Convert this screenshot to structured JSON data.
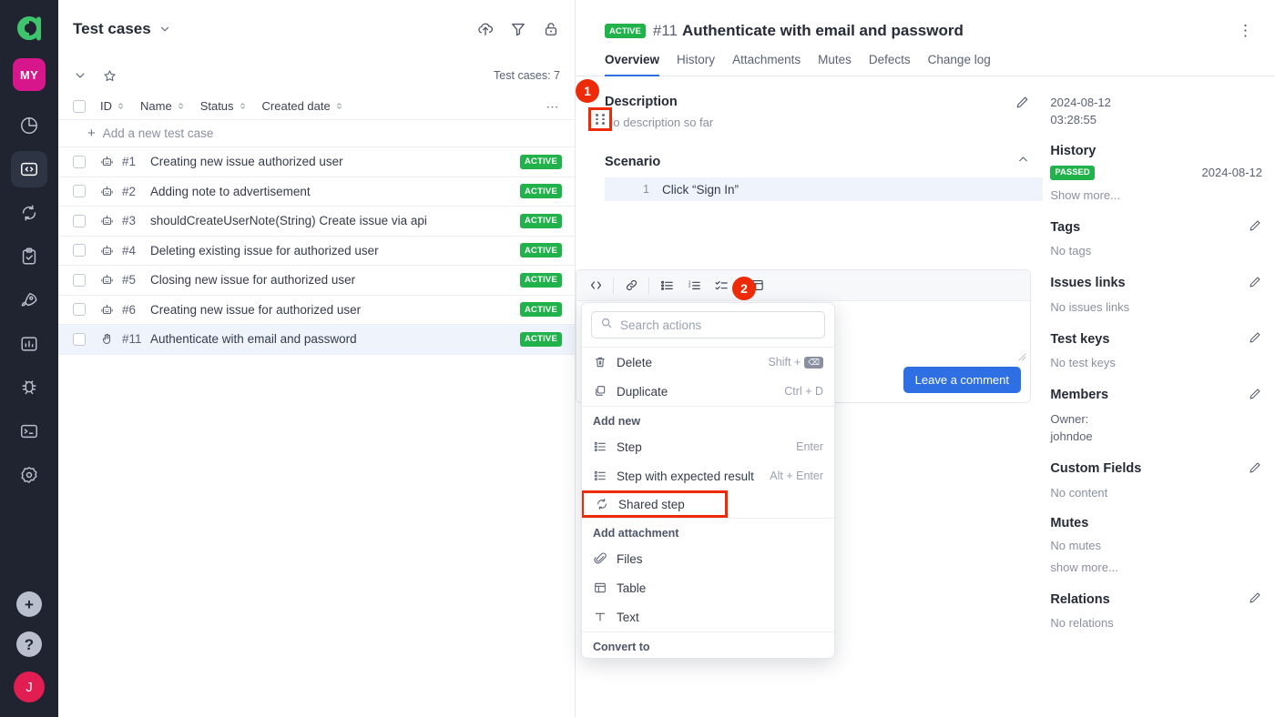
{
  "rail": {
    "logo_name": "allure-logo",
    "project_badge": "MY",
    "nav": [
      {
        "id": "dashboards",
        "icon": "pie-chart-icon",
        "active": false
      },
      {
        "id": "test-cases",
        "icon": "code-brackets-icon",
        "active": true
      },
      {
        "id": "shared-steps",
        "icon": "sync-arrows-icon",
        "active": false
      },
      {
        "id": "test-plans",
        "icon": "clipboard-check-icon",
        "active": false
      },
      {
        "id": "launches",
        "icon": "rocket-icon",
        "active": false
      },
      {
        "id": "analytics",
        "icon": "bar-chart-icon",
        "active": false
      },
      {
        "id": "defects",
        "icon": "bug-icon",
        "active": false
      },
      {
        "id": "jobs",
        "icon": "terminal-icon",
        "active": false
      },
      {
        "id": "settings",
        "icon": "gear-icon",
        "active": false
      }
    ],
    "bottom": [
      {
        "id": "create",
        "icon": "plus-icon",
        "glyph": "+"
      },
      {
        "id": "help",
        "icon": "question-icon",
        "glyph": "?"
      },
      {
        "id": "user-avatar",
        "icon": "avatar",
        "glyph": "J"
      }
    ]
  },
  "list": {
    "title": "Test cases",
    "title_chevron": "chevron-down-icon",
    "header_tools": [
      "upload-icon",
      "filter-icon",
      "unlock-icon"
    ],
    "subbar_icons": [
      "chevron-down-icon",
      "star-icon"
    ],
    "count_label": "Test cases: 7",
    "columns": [
      "ID",
      "Name",
      "Status",
      "Created date"
    ],
    "more_label": "⋯",
    "add_row_label": "Add a new test case",
    "rows": [
      {
        "id": "#1",
        "name": "Creating new issue authorized user",
        "status": "ACTIVE",
        "icon": "automated-icon",
        "selected": false
      },
      {
        "id": "#2",
        "name": "Adding note to advertisement",
        "status": "ACTIVE",
        "icon": "automated-icon",
        "selected": false
      },
      {
        "id": "#3",
        "name": "shouldCreateUserNote(String) Create issue via api",
        "status": "ACTIVE",
        "icon": "automated-icon",
        "selected": false
      },
      {
        "id": "#4",
        "name": "Deleting existing issue for authorized user",
        "status": "ACTIVE",
        "icon": "automated-icon",
        "selected": false
      },
      {
        "id": "#5",
        "name": "Closing new issue for authorized user",
        "status": "ACTIVE",
        "icon": "automated-icon",
        "selected": false
      },
      {
        "id": "#6",
        "name": "Creating new issue for authorized user",
        "status": "ACTIVE",
        "icon": "automated-icon",
        "selected": false
      },
      {
        "id": "#11",
        "name": "Authenticate with email and password",
        "status": "ACTIVE",
        "icon": "manual-hand-icon",
        "selected": true
      }
    ]
  },
  "detail": {
    "status_badge": "ACTIVE",
    "number": "#11",
    "title": "Authenticate with email and password",
    "kebab": "⋮",
    "tabs": [
      {
        "label": "Overview",
        "active": true
      },
      {
        "label": "History",
        "active": false
      },
      {
        "label": "Attachments",
        "active": false
      },
      {
        "label": "Mutes",
        "active": false
      },
      {
        "label": "Defects",
        "active": false
      },
      {
        "label": "Change log",
        "active": false
      }
    ],
    "description": {
      "heading": "Description",
      "empty_text": "No description so far",
      "edit_icon": "pencil-icon"
    },
    "scenario": {
      "heading": "Scenario",
      "collapse_icon": "chevron-up-icon",
      "drag_handle_icon": "drag-handle-icon",
      "steps": [
        {
          "num": "1",
          "text": "Click “Sign In”"
        }
      ]
    },
    "editor": {
      "toolbar_icons": [
        "code-icon",
        "link-icon",
        "bullet-list-icon",
        "numbered-list-icon",
        "checklist-icon",
        "table-icon"
      ],
      "resize_grip": "resize-grip-icon",
      "comment_button": "Leave a comment"
    }
  },
  "context_menu": {
    "search_placeholder": "Search actions",
    "search_icon": "search-icon",
    "items_top": [
      {
        "label": "Delete",
        "icon": "trash-icon",
        "shortcut": "Shift +",
        "shortcut_key": "⌫"
      },
      {
        "label": "Duplicate",
        "icon": "duplicate-icon",
        "shortcut": "Ctrl + D",
        "shortcut_key": ""
      }
    ],
    "group_add_new": "Add new",
    "items_add_new": [
      {
        "label": "Step",
        "icon": "step-icon",
        "shortcut": "Enter",
        "highlighted": false
      },
      {
        "label": "Step with expected result",
        "icon": "step-result-icon",
        "shortcut": "Alt + Enter",
        "highlighted": false
      },
      {
        "label": "Shared step",
        "icon": "shared-step-icon",
        "shortcut": "",
        "highlighted": true
      }
    ],
    "group_add_attachment": "Add attachment",
    "items_attachment": [
      {
        "label": "Files",
        "icon": "paperclip-icon"
      },
      {
        "label": "Table",
        "icon": "table-icon"
      },
      {
        "label": "Text",
        "icon": "text-icon"
      }
    ],
    "group_convert_to": "Convert to"
  },
  "meta": {
    "created_date": "2024-08-12",
    "created_time": "03:28:55",
    "history": {
      "heading": "History",
      "status": "PASSED",
      "date": "2024-08-12",
      "show_more": "Show more..."
    },
    "blocks": [
      {
        "heading": "Tags",
        "value": "No tags",
        "edit_icon": "pencil-icon"
      },
      {
        "heading": "Issues links",
        "value": "No issues links",
        "edit_icon": "pencil-icon"
      },
      {
        "heading": "Test keys",
        "value": "No test keys",
        "edit_icon": "pencil-icon"
      }
    ],
    "members": {
      "heading": "Members",
      "owner_label": "Owner:",
      "owner_name": "johndoe",
      "edit_icon": "pencil-icon"
    },
    "custom_fields": {
      "heading": "Custom Fields",
      "value": "No content",
      "edit_icon": "pencil-icon"
    },
    "mutes": {
      "heading": "Mutes",
      "value": "No mutes",
      "show_more": "show more..."
    },
    "relations": {
      "heading": "Relations",
      "value": "No relations",
      "edit_icon": "pencil-icon"
    }
  },
  "annotations": [
    {
      "number": "1",
      "target": "drag-handle"
    },
    {
      "number": "2",
      "target": "shared-step-menu-item"
    }
  ],
  "colors": {
    "rail_bg": "#1f2430",
    "accent_blue": "#2f6fe4",
    "status_green": "#21b24b",
    "annotation_red": "#ee2b09",
    "project_magenta": "#d6168a",
    "avatar_red": "#e11d52",
    "row_selected": "#eef3fc"
  }
}
